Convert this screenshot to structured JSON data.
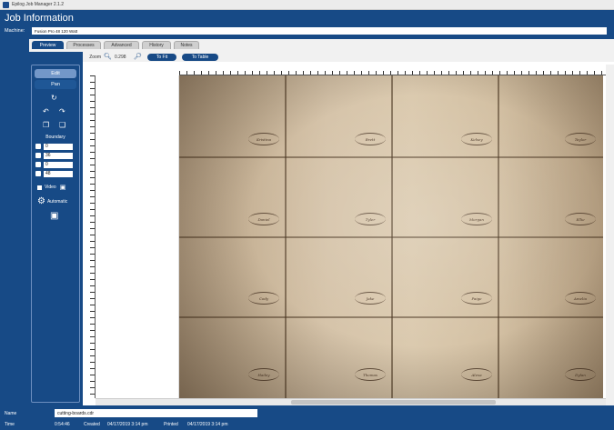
{
  "window": {
    "title": "Epilog Job Manager 2.1.2"
  },
  "header": {
    "title": "Job Information"
  },
  "machine": {
    "label": "Machine:",
    "value": "Fusion Pro 48 120 Watt"
  },
  "tabs": [
    {
      "label": "Preview",
      "active": true
    },
    {
      "label": "Processes",
      "active": false
    },
    {
      "label": "Advanced",
      "active": false
    },
    {
      "label": "History",
      "active": false
    },
    {
      "label": "Notes",
      "active": false
    }
  ],
  "toolbar": {
    "zoom_label": "Zoom",
    "zoom_value": "0.298",
    "to_fit_label": "To Fit",
    "to_table_label": "To Table"
  },
  "sidebar": {
    "edit_label": "Edit",
    "pan_label": "Pan",
    "boundary_label": "Boundary",
    "boundary_values": [
      "0",
      "36",
      "0",
      "48"
    ],
    "video_label": "Video",
    "automatic_label": "Automatic"
  },
  "boards": [
    [
      "Kristina",
      "Brett",
      "Kelsey",
      "Taylor"
    ],
    [
      "Daniel",
      "Tyler",
      "Morgan",
      "Ellie"
    ],
    [
      "Cody",
      "Jake",
      "Paige",
      "Amelia"
    ],
    [
      "Hailey",
      "Thomas",
      "Alexa",
      "Dylan"
    ]
  ],
  "footer": {
    "name_label": "Name",
    "name_value": "cutting-boards.cdr",
    "time_label": "Time",
    "time_value": "0:54:46",
    "created_label": "Created",
    "created_value": "04/17/2019 3:14 pm",
    "printed_label": "Printed",
    "printed_value": "04/17/2019 3:14 pm"
  },
  "colors": {
    "primary": "#174a86",
    "button_light": "#7397c8"
  }
}
